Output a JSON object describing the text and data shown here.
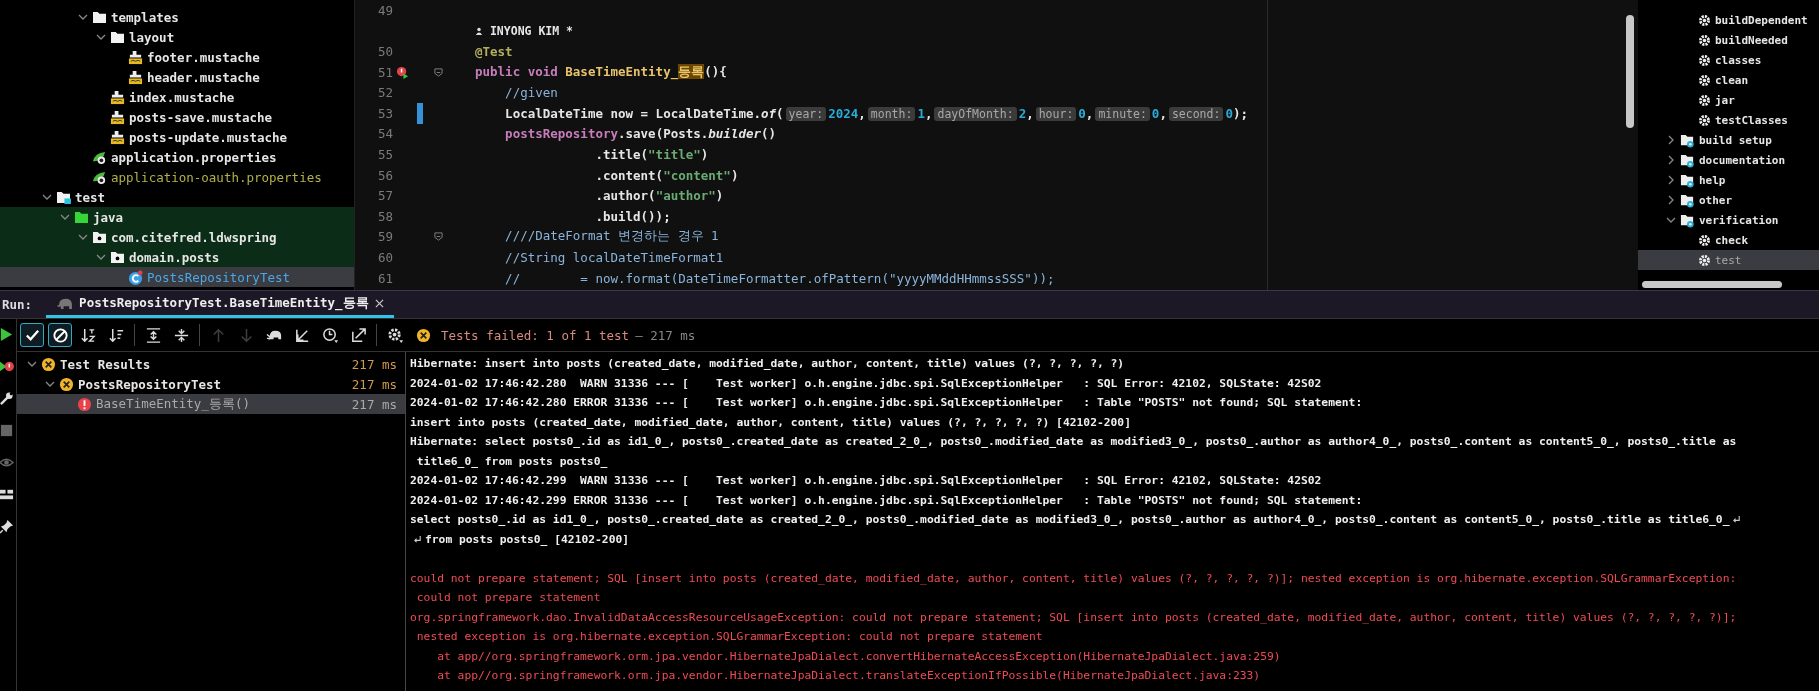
{
  "project_tree": {
    "continued": [
      {
        "label": "templates",
        "kind": "folder",
        "expanded": true,
        "children": [
          {
            "label": "layout",
            "kind": "folder",
            "expanded": true,
            "children": [
              {
                "label": "footer.mustache",
                "kind": "mustache"
              },
              {
                "label": "header.mustache",
                "kind": "mustache"
              }
            ]
          },
          {
            "label": "index.mustache",
            "kind": "mustache"
          },
          {
            "label": "posts-save.mustache",
            "kind": "mustache"
          },
          {
            "label": "posts-update.mustache",
            "kind": "mustache"
          }
        ]
      },
      {
        "label": "application.properties",
        "kind": "properties",
        "ignored": false
      },
      {
        "label": "application-oauth.properties",
        "kind": "properties",
        "ignored": true
      }
    ],
    "items": [
      {
        "label": "test",
        "kind": "test-folder",
        "expanded": true,
        "children": [
          {
            "label": "java",
            "kind": "source-folder",
            "expanded": true,
            "in_scope": true,
            "children": [
              {
                "label": "com.citefred.ldwspring",
                "kind": "package",
                "expanded": true,
                "in_scope": true,
                "children": [
                  {
                    "label": "domain.posts",
                    "kind": "package",
                    "expanded": true,
                    "in_scope": true,
                    "children": [
                      {
                        "label": "PostsRepositoryTest",
                        "kind": "test-class",
                        "selected": true
                      }
                    ]
                  }
                ]
              }
            ]
          }
        ]
      }
    ]
  },
  "editor": {
    "lines": [
      {
        "number": "49"
      },
      {
        "kind": "author",
        "author": "INYONG KIM *"
      },
      {
        "number": "50",
        "segments": [
          {
            "text": "@Test",
            "kind": "annotation"
          }
        ]
      },
      {
        "number": "51",
        "run_marker": true,
        "fold": true,
        "segments": [
          {
            "text": "public void ",
            "kind": "keyword"
          },
          {
            "text": "BaseTimeEntity_",
            "kind": "method"
          },
          {
            "text": "등록",
            "kind": "match"
          },
          {
            "text": "(){",
            "kind": "plain"
          }
        ]
      },
      {
        "number": "52",
        "segments": [
          {
            "text": "    //given",
            "kind": "comment"
          }
        ]
      },
      {
        "number": "53",
        "changed": true,
        "segments": [
          {
            "text": "    LocalDateTime now = LocalDateTime.",
            "kind": "plain"
          },
          {
            "text": "of",
            "kind": "italic"
          },
          {
            "text": "(",
            "kind": "plain"
          },
          {
            "text": "year:",
            "kind": "hint"
          },
          {
            "text": "2024",
            "kind": "number"
          },
          {
            "text": ",",
            "kind": "plain"
          },
          {
            "text": "month:",
            "kind": "hint"
          },
          {
            "text": "1",
            "kind": "number"
          },
          {
            "text": ",",
            "kind": "plain"
          },
          {
            "text": "dayOfMonth:",
            "kind": "hint"
          },
          {
            "text": "2",
            "kind": "number"
          },
          {
            "text": ",",
            "kind": "plain"
          },
          {
            "text": "hour:",
            "kind": "hint"
          },
          {
            "text": "0",
            "kind": "number"
          },
          {
            "text": ",",
            "kind": "plain"
          },
          {
            "text": "minute:",
            "kind": "hint"
          },
          {
            "text": "0",
            "kind": "number"
          },
          {
            "text": ",",
            "kind": "plain"
          },
          {
            "text": "second:",
            "kind": "hint"
          },
          {
            "text": "0",
            "kind": "number"
          },
          {
            "text": ");",
            "kind": "plain"
          }
        ]
      },
      {
        "number": "54",
        "segments": [
          {
            "text": "    postsRepository",
            "kind": "field"
          },
          {
            "text": ".save(Posts.",
            "kind": "plain"
          },
          {
            "text": "builder",
            "kind": "italic"
          },
          {
            "text": "()",
            "kind": "plain"
          }
        ]
      },
      {
        "number": "55",
        "segments": [
          {
            "text": "                .title(",
            "kind": "plain"
          },
          {
            "text": "\"title\"",
            "kind": "string"
          },
          {
            "text": ")",
            "kind": "plain"
          }
        ]
      },
      {
        "number": "56",
        "segments": [
          {
            "text": "                .content(",
            "kind": "plain"
          },
          {
            "text": "\"content\"",
            "kind": "string"
          },
          {
            "text": ")",
            "kind": "plain"
          }
        ]
      },
      {
        "number": "57",
        "segments": [
          {
            "text": "                .author(",
            "kind": "plain"
          },
          {
            "text": "\"author\"",
            "kind": "string"
          },
          {
            "text": ")",
            "kind": "plain"
          }
        ]
      },
      {
        "number": "58",
        "segments": [
          {
            "text": "                .build());",
            "kind": "plain"
          }
        ]
      },
      {
        "number": "59",
        "fold": true,
        "segments": [
          {
            "text": "    ////DateFormat 변경하는 경우 1",
            "kind": "comment"
          }
        ]
      },
      {
        "number": "60",
        "segments": [
          {
            "text": "    //String localDateTimeFormat1",
            "kind": "comment"
          }
        ]
      },
      {
        "number": "61",
        "segments": [
          {
            "text": "    //        = now.format(DateTimeFormatter.ofPattern(\"yyyyMMddHHmmssSSS\"));",
            "kind": "comment"
          }
        ]
      }
    ]
  },
  "gradle_panel": {
    "continued_tasks": [
      {
        "label": "buildDependent",
        "selected": false
      },
      {
        "label": "buildNeeded",
        "selected": false
      },
      {
        "label": "classes",
        "selected": false
      },
      {
        "label": "clean",
        "selected": false
      },
      {
        "label": "jar",
        "selected": false
      },
      {
        "label": "testClasses",
        "selected": false
      }
    ],
    "groups": [
      {
        "label": "build setup",
        "expanded": false
      },
      {
        "label": "documentation",
        "expanded": false
      },
      {
        "label": "help",
        "expanded": false
      },
      {
        "label": "other",
        "expanded": false
      },
      {
        "label": "verification",
        "expanded": true,
        "children": [
          {
            "label": "check",
            "selected": false
          },
          {
            "label": "test",
            "selected": true
          }
        ]
      }
    ]
  },
  "run_panel": {
    "label": "Run:",
    "tabs": [
      {
        "label": "PostsRepositoryTest.BaseTimeEntity_등록",
        "selected": true
      }
    ],
    "side_tools": [
      {
        "kind": "rerun"
      },
      {
        "kind": "rerun-failed"
      },
      {
        "kind": "wrench"
      },
      {
        "kind": "stop"
      },
      {
        "kind": "eye"
      },
      {
        "kind": "layout"
      },
      {
        "kind": "pin"
      }
    ],
    "toolbar": [
      {
        "kind": "check",
        "toggled": true,
        "disabled": false
      },
      {
        "kind": "ignore",
        "toggled": true,
        "disabled": false
      },
      {
        "kind": "sort-alpha",
        "toggled": false,
        "disabled": false
      },
      {
        "kind": "sort-duration",
        "toggled": false,
        "disabled": false
      },
      {
        "kind": "sep"
      },
      {
        "kind": "expand",
        "toggled": false,
        "disabled": false
      },
      {
        "kind": "collapse",
        "toggled": false,
        "disabled": false
      },
      {
        "kind": "sep"
      },
      {
        "kind": "up",
        "toggled": false,
        "disabled": true
      },
      {
        "kind": "down",
        "toggled": false,
        "disabled": true
      },
      {
        "kind": "elephant",
        "toggled": false,
        "disabled": false
      },
      {
        "kind": "import",
        "toggled": false,
        "disabled": false
      },
      {
        "kind": "history",
        "toggled": false,
        "disabled": false
      },
      {
        "kind": "export",
        "toggled": false,
        "disabled": false
      },
      {
        "kind": "sep"
      },
      {
        "kind": "settings",
        "toggled": false,
        "disabled": false
      }
    ],
    "status": {
      "text": "Tests failed: 1 of 1 test",
      "duration": "– 217 ms"
    },
    "test_tree": [
      {
        "label": "Test Results",
        "kind": "failed",
        "duration": "217 ms",
        "expanded": true,
        "selected": false,
        "children": [
          {
            "label": "PostsRepositoryTest",
            "kind": "failed",
            "duration": "217 ms",
            "expanded": true,
            "selected": false,
            "children": [
              {
                "label": "BaseTimeEntity_등록()",
                "kind": "error",
                "duration": "217 ms",
                "selected": true
              }
            ]
          }
        ]
      }
    ],
    "console": [
      {
        "kind": "log",
        "text": "Hibernate: insert into posts (created_date, modified_date, author, content, title) values (?, ?, ?, ?, ?)"
      },
      {
        "kind": "log",
        "text": "2024-01-02 17:46:42.280  WARN 31336 --- [    Test worker] o.h.engine.jdbc.spi.SqlExceptionHelper   : SQL Error: 42102, SQLState: 42S02"
      },
      {
        "kind": "log",
        "text": "2024-01-02 17:46:42.280 ERROR 31336 --- [    Test worker] o.h.engine.jdbc.spi.SqlExceptionHelper   : Table \"POSTS\" not found; SQL statement:"
      },
      {
        "kind": "log",
        "text": "insert into posts (created_date, modified_date, author, content, title) values (?, ?, ?, ?, ?) [42102-200]"
      },
      {
        "kind": "log",
        "text": "Hibernate: select posts0_.id as id1_0_, posts0_.created_date as created_2_0_, posts0_.modified_date as modified3_0_, posts0_.author as author4_0_, posts0_.content as content5_0_, posts0_.title as"
      },
      {
        "kind": "log",
        "text": " title6_0_ from posts posts0_"
      },
      {
        "kind": "log",
        "text": "2024-01-02 17:46:42.299  WARN 31336 --- [    Test worker] o.h.engine.jdbc.spi.SqlExceptionHelper   : SQL Error: 42102, SQLState: 42S02"
      },
      {
        "kind": "log",
        "text": "2024-01-02 17:46:42.299 ERROR 31336 --- [    Test worker] o.h.engine.jdbc.spi.SqlExceptionHelper   : Table \"POSTS\" not found; SQL statement:"
      },
      {
        "kind": "log",
        "wrap_end": true,
        "text": "select posts0_.id as id1_0_, posts0_.created_date as created_2_0_, posts0_.modified_date as modified3_0_, posts0_.author as author4_0_, posts0_.content as content5_0_, posts0_.title as title6_0_"
      },
      {
        "kind": "log",
        "wrap_start": true,
        "text": "from posts posts0_ [42102-200]"
      },
      {
        "kind": "blank"
      },
      {
        "kind": "error",
        "text": "could not prepare statement; SQL [insert into posts (created_date, modified_date, author, content, title) values (?, ?, ?, ?, ?)]; nested exception is org.hibernate.exception.SQLGrammarException:"
      },
      {
        "kind": "error",
        "text": " could not prepare statement"
      },
      {
        "kind": "error",
        "text": "org.springframework.dao.InvalidDataAccessResourceUsageException: could not prepare statement; SQL [insert into posts (created_date, modified_date, author, content, title) values (?, ?, ?, ?, ?)];"
      },
      {
        "kind": "error",
        "text": " nested exception is org.hibernate.exception.SQLGrammarException: could not prepare statement"
      },
      {
        "kind": "error",
        "text": "    at app//org.springframework.orm.jpa.vendor.HibernateJpaDialect.convertHibernateAccessException(HibernateJpaDialect.java:259)"
      },
      {
        "kind": "error",
        "text": "    at app//org.springframework.orm.jpa.vendor.HibernateJpaDialect.translateExceptionIfPossible(HibernateJpaDialect.java:233)"
      }
    ]
  }
}
